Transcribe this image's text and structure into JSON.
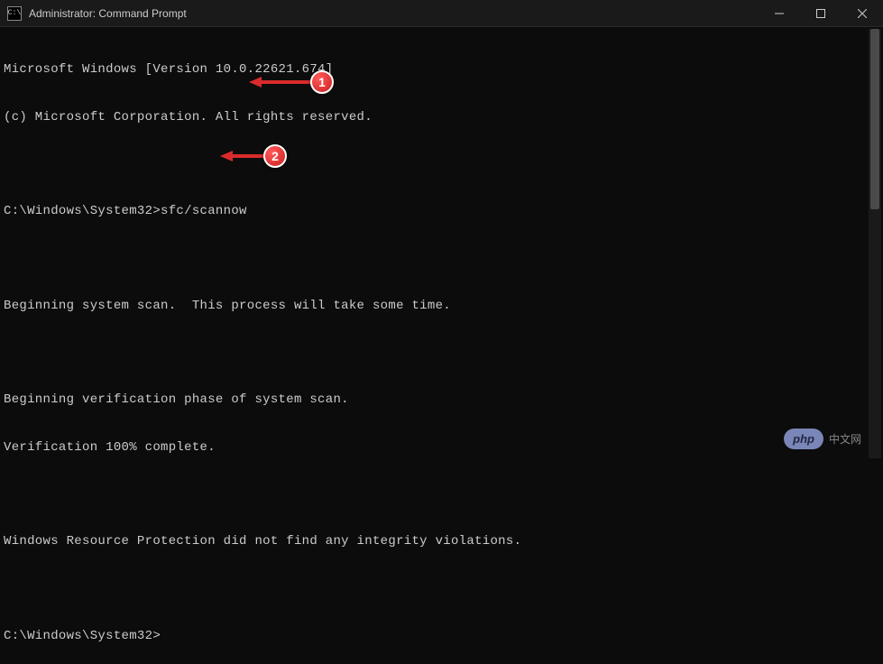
{
  "window": {
    "title": "Administrator: Command Prompt",
    "icon_label": "C:\\"
  },
  "terminal": {
    "lines": [
      "Microsoft Windows [Version 10.0.22621.674]",
      "(c) Microsoft Corporation. All rights reserved.",
      "",
      "C:\\Windows\\System32>sfc/scannow",
      "",
      "Beginning system scan.  This process will take some time.",
      "",
      "Beginning verification phase of system scan.",
      "Verification 100% complete.",
      "",
      "Windows Resource Protection did not find any integrity violations.",
      "",
      "C:\\Windows\\System32>"
    ]
  },
  "annotations": {
    "arrow1": {
      "number": "1"
    },
    "arrow2": {
      "number": "2"
    }
  },
  "watermark": {
    "logo": "php",
    "text": "中文网"
  }
}
